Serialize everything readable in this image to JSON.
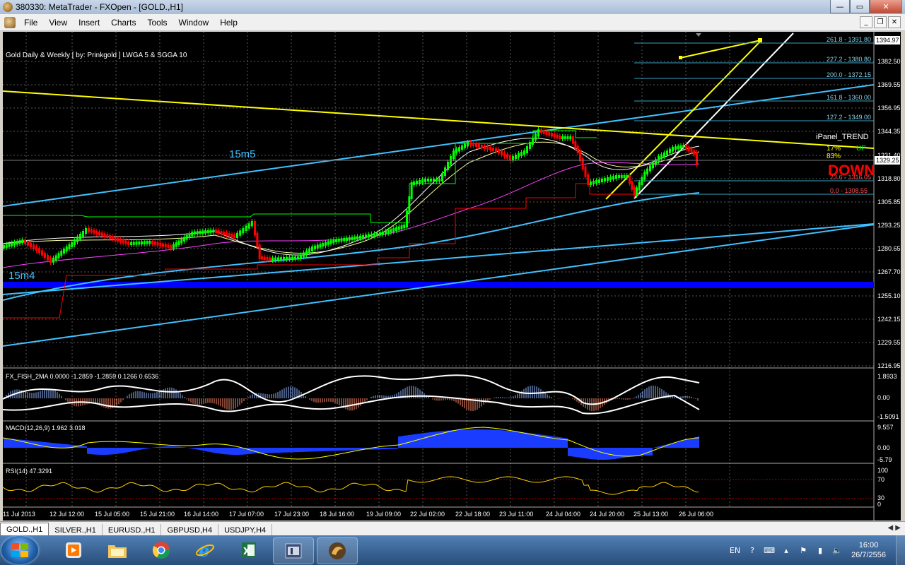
{
  "window": {
    "title": "380330: MetaTrader - FXOpen - [GOLD.,H1]"
  },
  "menu": [
    "File",
    "View",
    "Insert",
    "Charts",
    "Tools",
    "Window",
    "Help"
  ],
  "chart": {
    "header": "Gold Daily & Weekly [ by: Prinkgold ]  LWGA 5  &  SGGA 10",
    "labels": {
      "m5": "15m5",
      "m4": "15m4"
    },
    "price_axis": [
      "1382.50",
      "1369.55",
      "1356.95",
      "1344.35",
      "1331.40",
      "1318.80",
      "1305.85",
      "1293.25",
      "1280.65",
      "1267.70",
      "1255.10",
      "1242.15",
      "1229.55",
      "1216.95"
    ],
    "current_price": "1329.25",
    "top_price": "1394.97",
    "fib_levels": [
      "261.8 - 1391.80",
      "227.2 - 1380.80",
      "200.0 - 1372.15",
      "161.8 - 1360.00",
      "127.2 - 1349.00",
      "23.6 - 1316.05",
      "0.0 - 1308.55"
    ],
    "ipanel": {
      "title": "iPanel_TREND",
      "pct1": "17%",
      "pct2": "83%",
      "up": "UP",
      "down": "DOWN"
    },
    "time_axis": [
      "11 Jul 2013",
      "12 Jul 12:00",
      "15 Jul 05:00",
      "15 Jul 21:00",
      "16 Jul 14:00",
      "17 Jul 07:00",
      "17 Jul 23:00",
      "18 Jul 16:00",
      "19 Jul 09:00",
      "22 Jul 02:00",
      "22 Jul 18:00",
      "23 Jul 11:00",
      "24 Jul 04:00",
      "24 Jul 20:00",
      "25 Jul 13:00",
      "26 Jul 06:00"
    ],
    "fisher": {
      "label": "FX_FISH_2MA 0.0000 -1.2859 -1.2859 0.1266 0.6536",
      "axis": [
        "1.8933",
        "0.00",
        "-1.5091"
      ]
    },
    "macd": {
      "label": "MACD(12,26,9) 1.962 3.018",
      "axis": [
        "9.557",
        "0.00",
        "-5.79"
      ]
    },
    "rsi": {
      "label": "RSI(14) 47.3291",
      "axis": [
        "100",
        "70",
        "30",
        "0"
      ]
    }
  },
  "tabs": [
    "GOLD.,H1",
    "SILVER.,H1",
    "EURUSD.,H1",
    "GBPUSD,H4",
    "USDJPY,H4"
  ],
  "active_tab": "GOLD.,H1",
  "taskbar": {
    "lang": "EN",
    "time": "16:00",
    "date": "26/7/2556"
  },
  "colors": {
    "bull": "#00ff00",
    "bear": "#ff0000",
    "trend": "#ffff00",
    "channel": "#40c0ff",
    "band": "#0000ff"
  }
}
